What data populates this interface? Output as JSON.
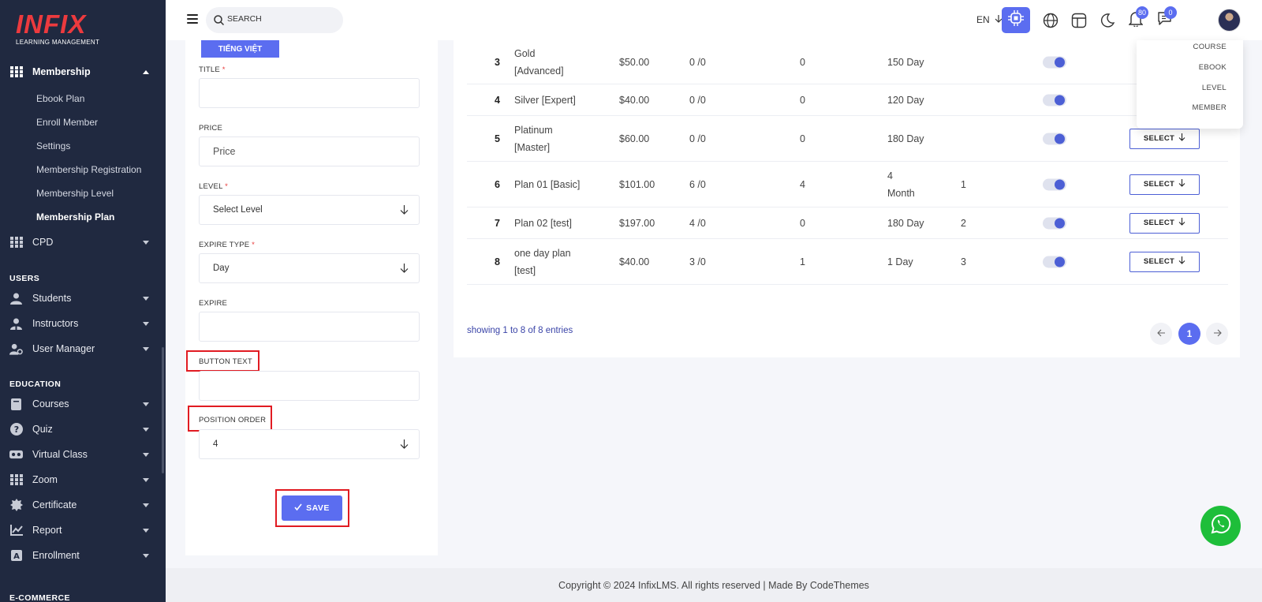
{
  "brand": {
    "name": "INFIX",
    "tagline": "LEARNING MANAGEMENT"
  },
  "sidebar": {
    "membership": "Membership",
    "sub_items": [
      "Ebook Plan",
      "Enroll Member",
      "Settings",
      "Membership Registration",
      "Membership Level",
      "Membership Plan"
    ],
    "cpd": "CPD",
    "section_users": "USERS",
    "students": "Students",
    "instructors": "Instructors",
    "user_manager": "User Manager",
    "section_education": "EDUCATION",
    "courses": "Courses",
    "quiz": "Quiz",
    "virtual_class": "Virtual Class",
    "zoom": "Zoom",
    "certificate": "Certificate",
    "report": "Report",
    "enrollment": "Enrollment",
    "section_ecommerce": "E-COMMERCE"
  },
  "header": {
    "search_placeholder": "SEARCH",
    "language": "EN",
    "notifications_count": "80",
    "messages_count": "0"
  },
  "form": {
    "language_tab": "TIẾNG VIỆT",
    "title_label": "TITLE",
    "price_label": "PRICE",
    "price_placeholder": "Price",
    "level_label": "LEVEL",
    "level_value": "Select Level",
    "expire_type_label": "EXPIRE TYPE",
    "expire_type_value": "Day",
    "expire_label": "EXPIRE",
    "button_text_label": "BUTTON TEXT",
    "position_order_label": "POSITION ORDER",
    "position_order_value": "4",
    "required_mark": "*",
    "save_label": "SAVE"
  },
  "table": {
    "select_label": "SELECT",
    "rows": [
      {
        "sl": "3",
        "name": "Gold [Advanced]",
        "price": "$50.00",
        "ratio": "0 /0",
        "count": "0",
        "duration": "150 Day",
        "position": ""
      },
      {
        "sl": "4",
        "name": "Silver [Expert]",
        "price": "$40.00",
        "ratio": "0 /0",
        "count": "0",
        "duration": "120 Day",
        "position": ""
      },
      {
        "sl": "5",
        "name": "Platinum [Master]",
        "price": "$60.00",
        "ratio": "0 /0",
        "count": "0",
        "duration": "180 Day",
        "position": ""
      },
      {
        "sl": "6",
        "name": "Plan 01 [Basic]",
        "price": "$101.00",
        "ratio": "6 /0",
        "count": "4",
        "duration": "4 Month",
        "position": "1"
      },
      {
        "sl": "7",
        "name": "Plan 02 [test]",
        "price": "$197.00",
        "ratio": "4 /0",
        "count": "0",
        "duration": "180 Day",
        "position": "2"
      },
      {
        "sl": "8",
        "name": "one day plan [test]",
        "price": "$40.00",
        "ratio": "3 /0",
        "count": "1",
        "duration": "1 Day",
        "position": "3"
      }
    ],
    "entries_text": "showing 1 to 8 of 8 entries",
    "current_page": "1"
  },
  "dropdown": {
    "options": [
      "COURSE",
      "EBOOK",
      "LEVEL",
      "MEMBER"
    ]
  },
  "footer": {
    "text": "Copyright © 2024 InfixLMS. All rights reserved | Made By CodeThemes"
  },
  "colors": {
    "primary": "#5b6df0",
    "sidebar": "#202940",
    "highlight": "#e11b22",
    "whatsapp": "#1ebe3a"
  }
}
